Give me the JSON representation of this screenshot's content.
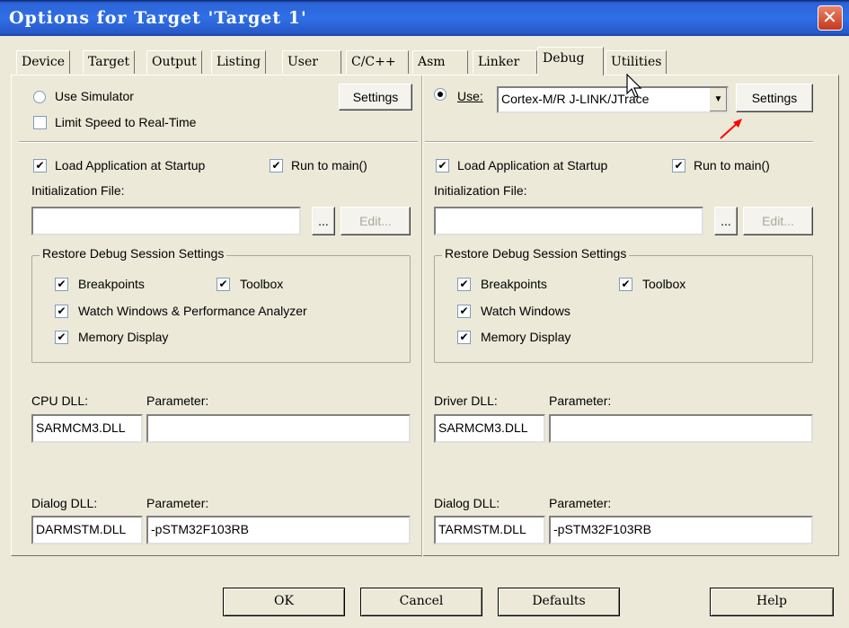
{
  "window": {
    "title": "Options for Target 'Target 1'",
    "close_glyph": "✕"
  },
  "tabs": [
    {
      "label": "Device"
    },
    {
      "label": "Target"
    },
    {
      "label": "Output"
    },
    {
      "label": "Listing"
    },
    {
      "label": "User"
    },
    {
      "label": "C/C++"
    },
    {
      "label": "Asm"
    },
    {
      "label": "Linker"
    },
    {
      "label": "Debug",
      "active": true
    },
    {
      "label": "Utilities"
    }
  ],
  "left": {
    "use_simulator_label": "Use Simulator",
    "use_simulator_checked": false,
    "limit_speed_label": "Limit Speed to Real-Time",
    "limit_speed_checked": false,
    "settings_label": "Settings",
    "load_app_label": "Load Application at Startup",
    "load_app_checked": true,
    "run_to_main_label": "Run to main()",
    "run_to_main_checked": true,
    "init_file_label": "Initialization File:",
    "init_file_value": "",
    "browse_label": "...",
    "edit_label": "Edit...",
    "restore_group_title": "Restore Debug Session Settings",
    "breakpoints_label": "Breakpoints",
    "toolbox_label": "Toolbox",
    "watch_label": "Watch Windows & Performance Analyzer",
    "memory_label": "Memory Display",
    "cpu_dll_label": "CPU DLL:",
    "cpu_dll_value": "SARMCM3.DLL",
    "cpu_param_label": "Parameter:",
    "cpu_param_value": "",
    "dialog_dll_label": "Dialog DLL:",
    "dialog_dll_value": "DARMSTM.DLL",
    "dialog_param_label": "Parameter:",
    "dialog_param_value": "-pSTM32F103RB"
  },
  "right": {
    "use_label": "Use:",
    "use_checked": true,
    "driver_value": "Cortex-M/R J-LINK/JTrace",
    "settings_label": "Settings",
    "load_app_label": "Load Application at Startup",
    "run_to_main_label": "Run to main()",
    "init_file_label": "Initialization File:",
    "init_file_value": "",
    "browse_label": "...",
    "edit_label": "Edit...",
    "restore_group_title": "Restore Debug Session Settings",
    "breakpoints_label": "Breakpoints",
    "toolbox_label": "Toolbox",
    "watch_label": "Watch Windows",
    "memory_label": "Memory Display",
    "driver_dll_label": "Driver DLL:",
    "driver_dll_value": "SARMCM3.DLL",
    "driver_param_label": "Parameter:",
    "driver_param_value": "",
    "dialog_dll_label": "Dialog DLL:",
    "dialog_dll_value": "TARMSTM.DLL",
    "dialog_param_label": "Parameter:",
    "dialog_param_value": "-pSTM32F103RB"
  },
  "footer": {
    "ok": "OK",
    "cancel": "Cancel",
    "defaults": "Defaults",
    "help": "Help"
  },
  "colors": {
    "title_bar": "#2f6fe6",
    "dialog_bg": "#ece9d8",
    "annotation_arrow": "#ff0000"
  },
  "check_glyph": "✔"
}
